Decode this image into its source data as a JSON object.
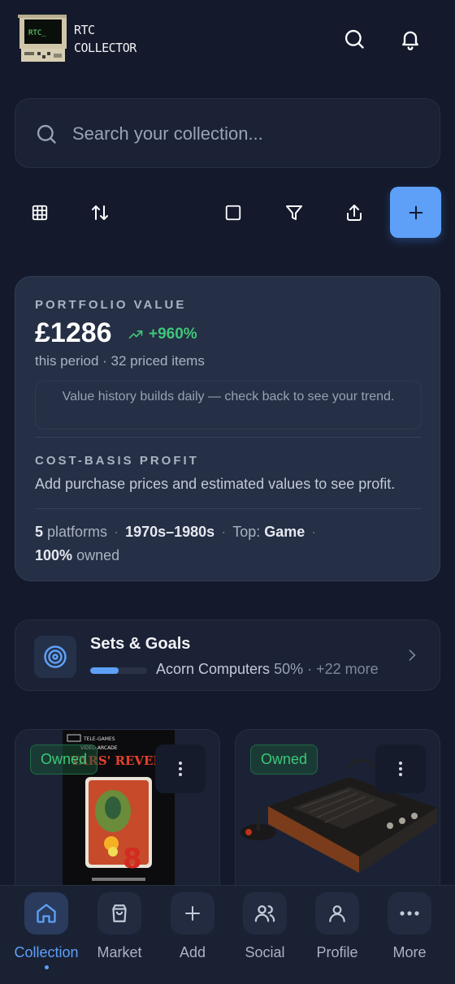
{
  "app": {
    "logo_screen_text": "RTC_",
    "name": "RTC\nCOLLECTOR"
  },
  "header": {
    "icons": [
      "search-icon",
      "bell-icon"
    ]
  },
  "search": {
    "placeholder": "Search your collection..."
  },
  "toolbar": {
    "icons": [
      "grid-icon",
      "sort-icon",
      "select-icon",
      "filter-icon",
      "share-icon",
      "plus-icon"
    ]
  },
  "portfolio": {
    "label": "PORTFOLIO VALUE",
    "value": "£1286",
    "change": "+960%",
    "period": "this period · 32 priced items",
    "note": "Value history builds daily — check back to see your trend.",
    "cost_basis_label": "COST-BASIS PROFIT",
    "cost_basis_text": "Add purchase prices and estimated values to see profit.",
    "stats": {
      "platforms_count": "5",
      "platforms_label": "platforms",
      "era": "1970s–1980s",
      "top_label": "Top:",
      "top_value": "Game",
      "owned_pct": "100%",
      "owned_label": "owned"
    }
  },
  "goals": {
    "title": "Sets & Goals",
    "progress": 0.5,
    "goal_name": "Acorn Computers",
    "goal_pct": "50%",
    "more": "+22 more"
  },
  "items": [
    {
      "status": "Owned",
      "art_publisher": "TELE-GAMES",
      "art_series": "VIDEO ARCADE",
      "art_title": "YARS' REVENGE",
      "art_number": "8"
    },
    {
      "status": "Owned"
    }
  ],
  "nav": [
    {
      "label": "Collection",
      "icon": "home-icon",
      "active": true
    },
    {
      "label": "Market",
      "icon": "shopping-bag-icon"
    },
    {
      "label": "Add",
      "icon": "plus-icon"
    },
    {
      "label": "Social",
      "icon": "users-icon"
    },
    {
      "label": "Profile",
      "icon": "user-icon"
    },
    {
      "label": "More",
      "icon": "more-icon"
    }
  ],
  "colors": {
    "background": "#141a2c",
    "accent": "#5ea0f7",
    "positive": "#3ec77a",
    "card": "#252f45"
  }
}
